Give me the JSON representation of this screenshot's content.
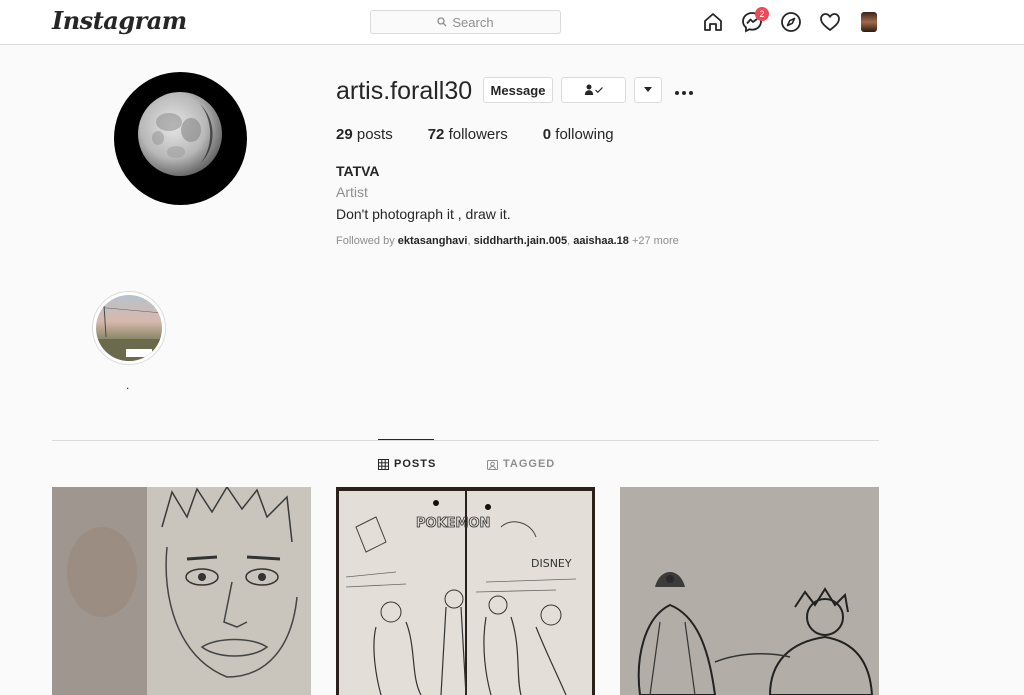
{
  "header": {
    "logo": "Instagram",
    "search_placeholder": "Search",
    "messages_badge": "2"
  },
  "profile": {
    "username": "artis.forall30",
    "message_button": "Message",
    "stats": {
      "posts_count": "29",
      "posts_label": "posts",
      "followers_count": "72",
      "followers_label": "followers",
      "following_count": "0",
      "following_label": "following"
    },
    "full_name": "TATVA",
    "category": "Artist",
    "bio": "Don't photograph it , draw it.",
    "followed_by_prefix": "Followed by ",
    "followed_by_users": [
      "ektasanghavi",
      "siddharth.jain.005",
      "aaishaa.18"
    ],
    "followed_by_more": "+27 more"
  },
  "highlights": [
    {
      "label": "."
    }
  ],
  "tabs": {
    "posts": "POSTS",
    "tagged": "TAGGED"
  },
  "icons": [
    "search-icon",
    "home-icon",
    "messenger-icon",
    "explore-icon",
    "heart-icon",
    "following-icon",
    "chevron-down-icon",
    "more-icon",
    "grid-icon",
    "tagged-icon"
  ]
}
